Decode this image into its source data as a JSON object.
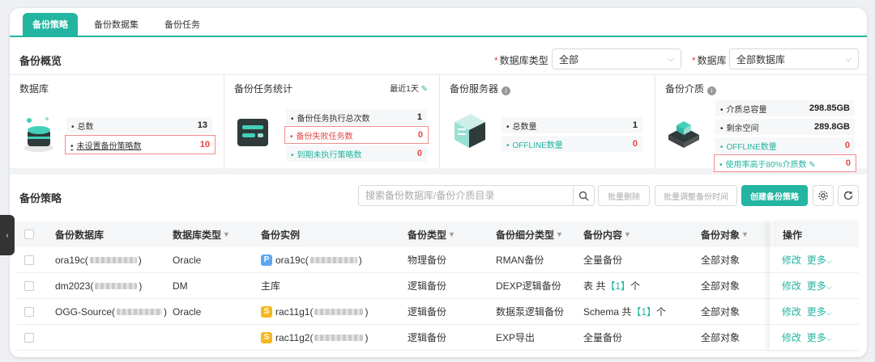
{
  "tabs": [
    "备份策略",
    "备份数据集",
    "备份任务"
  ],
  "overview": {
    "title": "备份概览",
    "db_type_label": "数据库类型",
    "db_type_value": "全部",
    "db_label": "数据库",
    "db_value": "全部数据库"
  },
  "cards": {
    "database": {
      "title": "数据库",
      "total_label": "总数",
      "total_value": "13",
      "unset_label": "未设置备份策略数",
      "unset_value": "10"
    },
    "tasks": {
      "title": "备份任务统计",
      "recent": "最近1天",
      "exec_label": "备份任务执行总次数",
      "exec_value": "1",
      "fail_label": "备份失败任务数",
      "fail_value": "0",
      "due_label": "到期未执行策略数",
      "due_value": "0"
    },
    "servers": {
      "title": "备份服务器",
      "total_label": "总数量",
      "total_value": "1",
      "offline_label": "OFFLINE数量",
      "offline_value": "0"
    },
    "media": {
      "title": "备份介质",
      "cap_label": "介质总容量",
      "cap_value": "298.85GB",
      "free_label": "剩余空间",
      "free_value": "289.8GB",
      "offline_label": "OFFLINE数量",
      "offline_value": "0",
      "usage_label": "使用率高于80%介质数",
      "usage_value": "0"
    }
  },
  "policy": {
    "title": "备份策略",
    "search_placeholder": "搜索备份数据库/备份介质目录",
    "batch_delete": "批量删除",
    "batch_adjust": "批量调整备份时间",
    "create": "创建备份策略"
  },
  "table": {
    "headers": [
      "备份数据库",
      "数据库类型",
      "备份实例",
      "备份类型",
      "备份细分类型",
      "备份内容",
      "备份对象",
      "操作"
    ],
    "rows": [
      {
        "db": "ora19c(",
        "db_end": ")",
        "dbtype": "Oracle",
        "inst_tag": "P",
        "inst": "ora19c(",
        "inst_end": ")",
        "btype": "物理备份",
        "subtype": "RMAN备份",
        "content": "全量备份",
        "target": "全部对象"
      },
      {
        "db": "dm2023(",
        "db_end": ")",
        "dbtype": "DM",
        "inst_tag": "",
        "inst": "主库",
        "inst_end": "",
        "btype": "逻辑备份",
        "subtype": "DEXP逻辑备份",
        "content_pre": "表 共",
        "content_num": "【1】",
        "content_post": "个",
        "target": "全部对象"
      },
      {
        "db": "OGG-Source(",
        "db_end": ")",
        "dbtype": "Oracle",
        "inst_tag": "S",
        "inst": "rac11g1(",
        "inst_end": ")",
        "btype": "逻辑备份",
        "subtype": "数据泵逻辑备份",
        "content_pre": "Schema 共",
        "content_num": "【1】",
        "content_post": "个",
        "target": "全部对象"
      },
      {
        "db": "",
        "db_end": "",
        "dbtype": "",
        "inst_tag": "S",
        "inst": "rac11g2(",
        "inst_end": ")",
        "btype": "逻辑备份",
        "subtype": "EXP导出",
        "content": "全量备份",
        "target": "全部对象"
      }
    ],
    "op_edit": "修改",
    "op_more": "更多"
  },
  "colors": {
    "accent": "#23b5a1",
    "danger": "#e64545",
    "tag_p": "#5aa9f0",
    "tag_s": "#f5b820"
  }
}
